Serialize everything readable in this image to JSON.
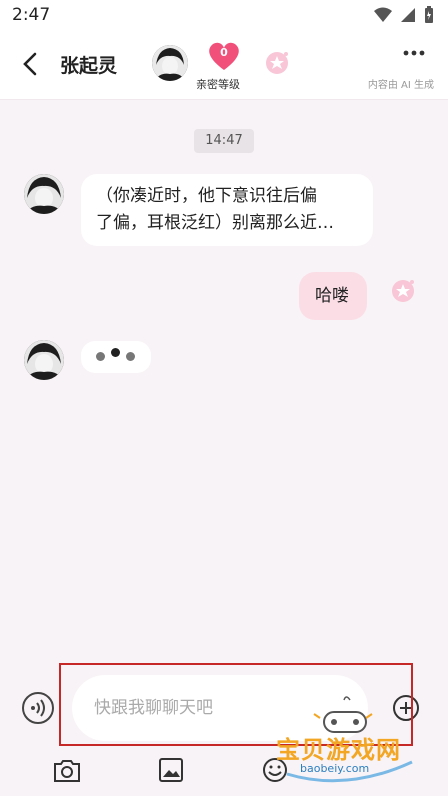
{
  "status_bar": {
    "time": "2:47"
  },
  "header": {
    "title": "张起灵",
    "intimacy_value": "0",
    "intimacy_label": "亲密等级",
    "ai_note": "内容由 AI 生成"
  },
  "messages": {
    "timestamp": "14:47",
    "bot_message_line1": "（你凑近时，他下意识往后偏",
    "bot_message_line2": "了偏，耳根泛红）别离那么近…",
    "user_message": "哈喽"
  },
  "input": {
    "placeholder": "快跟我聊聊天吧"
  },
  "watermark": {
    "text": "宝贝游戏网",
    "url": "baobeiy.com"
  },
  "colors": {
    "accent_pink": "#f0507a",
    "user_bubble": "#fbdde6",
    "highlight": "#c62828"
  }
}
